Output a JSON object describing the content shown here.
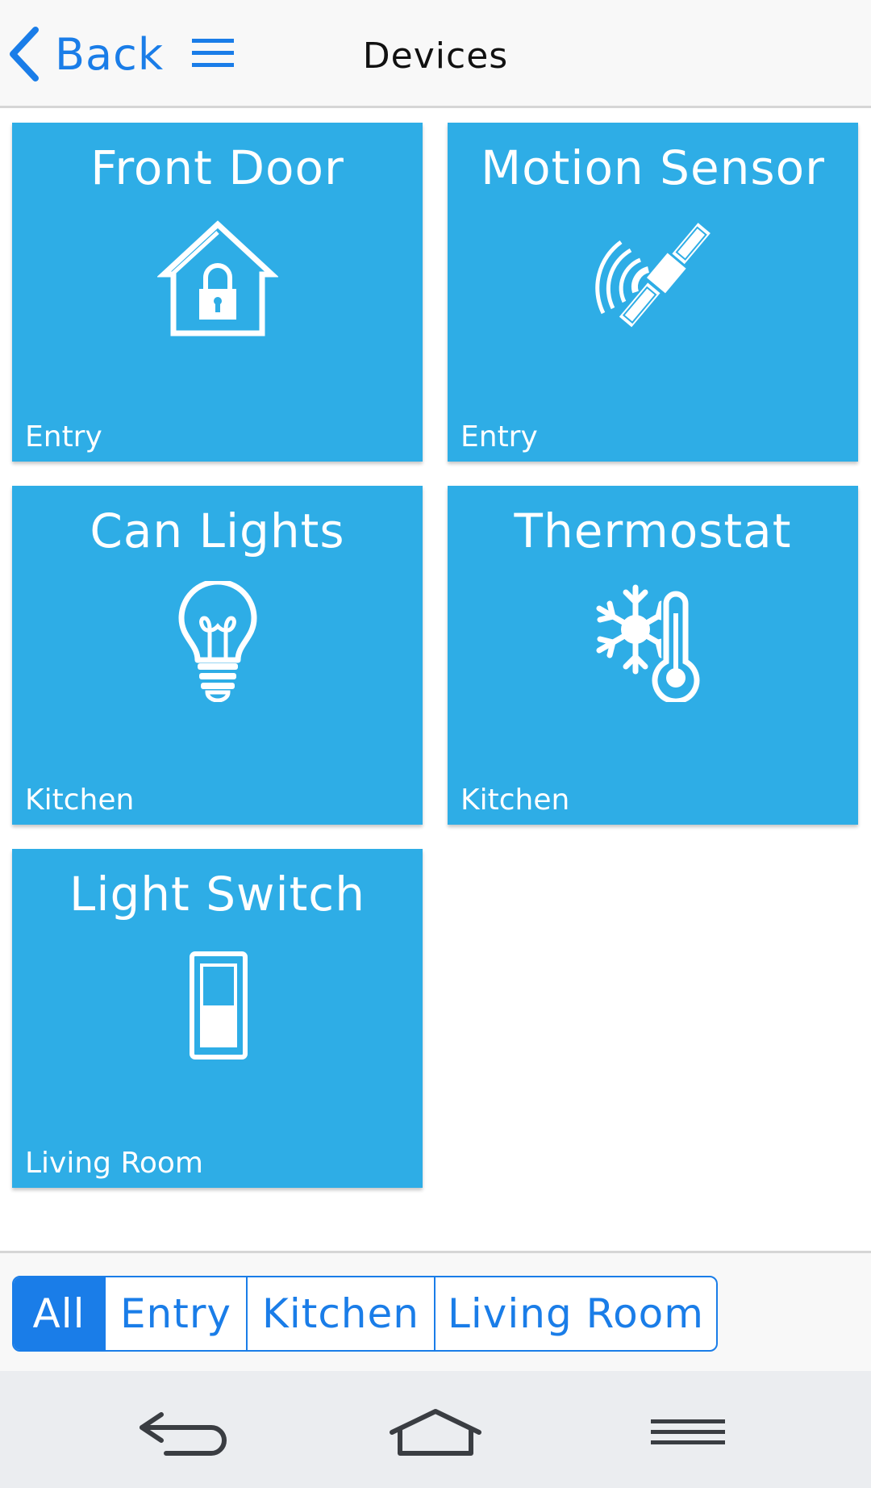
{
  "header": {
    "back_label": "Back",
    "title": "Devices"
  },
  "devices": [
    {
      "name": "Front Door",
      "room": "Entry",
      "icon": "house-lock-icon"
    },
    {
      "name": "Motion Sensor",
      "room": "Entry",
      "icon": "satellite-icon"
    },
    {
      "name": "Can Lights",
      "room": "Kitchen",
      "icon": "lightbulb-icon"
    },
    {
      "name": "Thermostat",
      "room": "Kitchen",
      "icon": "snowflake-thermometer-icon"
    },
    {
      "name": "Light Switch",
      "room": "Living Room",
      "icon": "light-switch-icon"
    }
  ],
  "filter": {
    "options": [
      "All",
      "Entry",
      "Kitchen",
      "Living Room"
    ],
    "selected": "All"
  },
  "navbar": {
    "icons": [
      "nav-back-icon",
      "nav-home-icon",
      "nav-menu-icon"
    ]
  },
  "colors": {
    "tile": "#2eade6",
    "accent": "#1a7de8",
    "header_bg": "#f8f8f8",
    "navbar_bg": "#ebedf0"
  }
}
